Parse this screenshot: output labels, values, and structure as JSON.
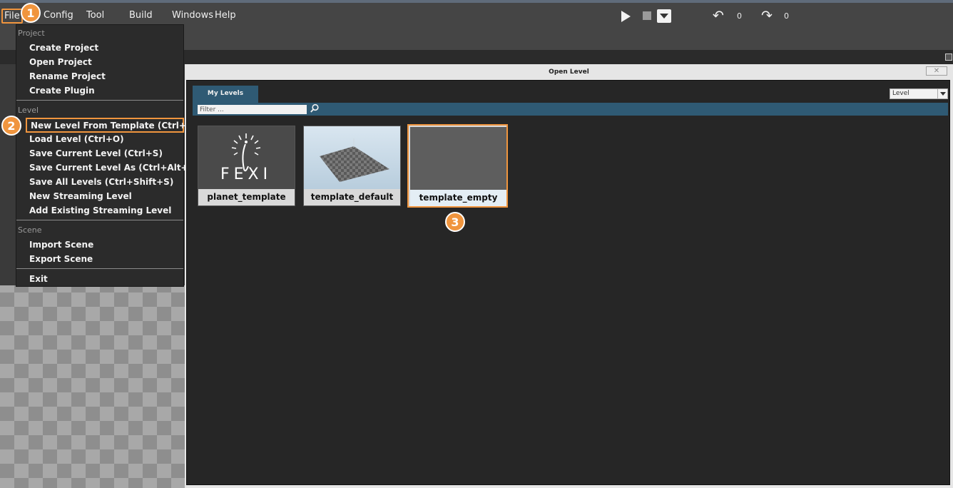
{
  "menubar": {
    "items": [
      "File",
      "Config",
      "Tool",
      "Build",
      "Windows",
      "Help"
    ]
  },
  "toolbar": {
    "undo_count": "0",
    "redo_count": "0"
  },
  "file_menu": {
    "sections": [
      {
        "header": "Project",
        "items": [
          "Create Project",
          "Open Project",
          "Rename Project",
          "Create Plugin"
        ]
      },
      {
        "header": "Level",
        "items": [
          "New Level From Template (Ctrl+N)",
          "Load Level (Ctrl+O)",
          "Save Current Level (Ctrl+S)",
          "Save Current Level As (Ctrl+Alt+S)",
          "Save All Levels (Ctrl+Shift+S)",
          "New Streaming Level",
          "Add Existing Streaming Level"
        ]
      },
      {
        "header": "Scene",
        "items": [
          "Import Scene",
          "Export Scene"
        ]
      },
      {
        "header": "",
        "items": [
          "Exit"
        ]
      }
    ]
  },
  "callouts": [
    "1",
    "2",
    "3"
  ],
  "dialog": {
    "title": "Open Level",
    "close_icon": "close-icon",
    "tab_label": "My Levels",
    "type_select_value": "Level",
    "filter_placeholder": "Filter ...",
    "levels": [
      {
        "name": "planet_template",
        "logo_text": "FEXI"
      },
      {
        "name": "template_default"
      },
      {
        "name": "template_empty"
      }
    ]
  },
  "colors": {
    "accent": "#f0953e",
    "tab_blue": "#2f5a74",
    "menu_bg": "#2b2b2b",
    "dialog_bg": "#262626"
  }
}
